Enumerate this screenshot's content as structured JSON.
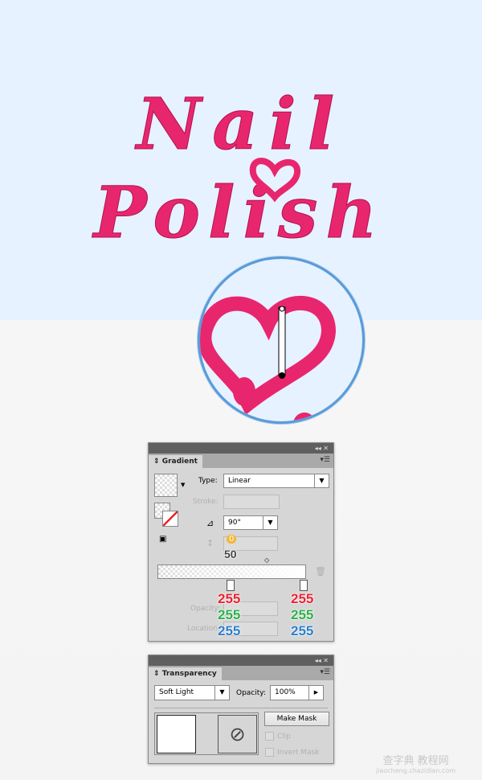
{
  "artwork": {
    "line1": "Nail",
    "line2": "Polish",
    "text_color": "#e8266e",
    "background": "#e6f2ff"
  },
  "gradient_panel": {
    "tab": "Gradient",
    "type_label": "Type:",
    "type_value": "Linear",
    "stroke_label": "Stroke:",
    "angle_value": "90°",
    "aspect_value": "0",
    "aspect_overlay": "50",
    "opacity_label": "Opacity:",
    "location_label": "Location:",
    "stops": [
      {
        "r": "255",
        "g": "255",
        "b": "255"
      },
      {
        "r": "255",
        "g": "255",
        "b": "255"
      }
    ],
    "colors": {
      "red": "#e8242f",
      "green": "#2db04a",
      "blue": "#2d7fc9",
      "yellow": "#f2b632"
    }
  },
  "transparency_panel": {
    "tab": "Transparency",
    "blend_mode": "Soft Light",
    "opacity_label": "Opacity:",
    "opacity_value": "100%",
    "make_mask": "Make Mask",
    "clip": "Clip",
    "invert_mask": "Invert Mask"
  },
  "watermark": {
    "line1": "查字典 教程网",
    "line2": "jiaocheng.chazidian.com"
  }
}
